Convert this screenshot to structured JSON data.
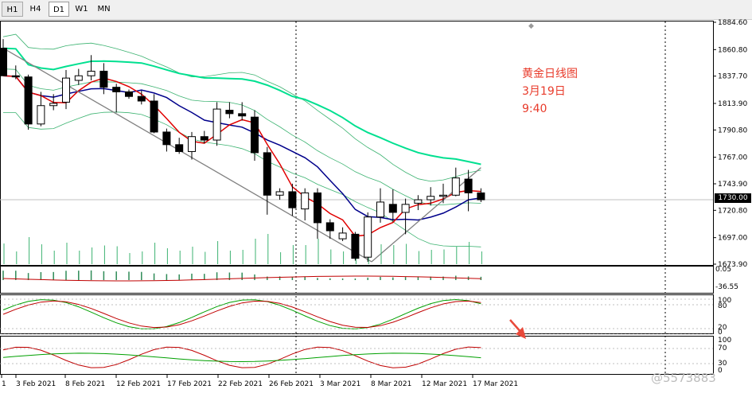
{
  "toolbar": {
    "timeframes": [
      "H1",
      "H4",
      "D1",
      "W1",
      "MN"
    ],
    "active": "D1"
  },
  "annotation": {
    "line1": "黄金日线图",
    "line2": "3月19日",
    "line3": "9:40"
  },
  "watermark": "@5573883",
  "colors": {
    "bull_candle": "#ffffff",
    "bear_candle": "#000000",
    "ma_red": "#e00000",
    "ma_blue": "#00008b",
    "ma_green": "#00e090",
    "bands": "#3cb371",
    "trendline": "#808080",
    "annotation": "#e83a2a",
    "arrow": "#e8493a"
  },
  "chart_data": {
    "type": "candlestick",
    "symbol_timeframe": "D1",
    "price_axis": {
      "ticks": [
        "1884.60",
        "1860.80",
        "1837.70",
        "1813.90",
        "1790.80",
        "1767.00",
        "1743.90",
        "1720.80",
        "1697.00",
        "1673.90"
      ],
      "ylim": [
        1673.9,
        1884.6
      ],
      "current_price": "1730.00"
    },
    "date_axis": [
      "1",
      "3 Feb 2021",
      "8 Feb 2021",
      "12 Feb 2021",
      "17 Feb 2021",
      "22 Feb 2021",
      "26 Feb 2021",
      "3 Mar 2021",
      "8 Mar 2021",
      "12 Mar 2021",
      "17 Mar 2021"
    ],
    "candles": [
      {
        "o": 1862,
        "h": 1870,
        "l": 1838,
        "c": 1838
      },
      {
        "o": 1838,
        "h": 1847,
        "l": 1835,
        "c": 1837
      },
      {
        "o": 1837,
        "h": 1839,
        "l": 1791,
        "c": 1796
      },
      {
        "o": 1796,
        "h": 1824,
        "l": 1794,
        "c": 1812
      },
      {
        "o": 1812,
        "h": 1822,
        "l": 1808,
        "c": 1814
      },
      {
        "o": 1815,
        "h": 1843,
        "l": 1809,
        "c": 1836
      },
      {
        "o": 1834,
        "h": 1844,
        "l": 1830,
        "c": 1838
      },
      {
        "o": 1838,
        "h": 1856,
        "l": 1834,
        "c": 1842
      },
      {
        "o": 1842,
        "h": 1849,
        "l": 1822,
        "c": 1828
      },
      {
        "o": 1828,
        "h": 1831,
        "l": 1806,
        "c": 1824
      },
      {
        "o": 1824,
        "h": 1826,
        "l": 1818,
        "c": 1820
      },
      {
        "o": 1820,
        "h": 1825,
        "l": 1813,
        "c": 1816
      },
      {
        "o": 1816,
        "h": 1822,
        "l": 1788,
        "c": 1789
      },
      {
        "o": 1789,
        "h": 1792,
        "l": 1772,
        "c": 1778
      },
      {
        "o": 1778,
        "h": 1784,
        "l": 1770,
        "c": 1772
      },
      {
        "o": 1772,
        "h": 1789,
        "l": 1765,
        "c": 1785
      },
      {
        "o": 1785,
        "h": 1790,
        "l": 1779,
        "c": 1782
      },
      {
        "o": 1782,
        "h": 1815,
        "l": 1777,
        "c": 1809
      },
      {
        "o": 1808,
        "h": 1815,
        "l": 1801,
        "c": 1805
      },
      {
        "o": 1805,
        "h": 1815,
        "l": 1799,
        "c": 1803
      },
      {
        "o": 1802,
        "h": 1808,
        "l": 1764,
        "c": 1771
      },
      {
        "o": 1771,
        "h": 1776,
        "l": 1717,
        "c": 1734
      },
      {
        "o": 1734,
        "h": 1740,
        "l": 1730,
        "c": 1737
      },
      {
        "o": 1737,
        "h": 1744,
        "l": 1716,
        "c": 1723
      },
      {
        "o": 1722,
        "h": 1740,
        "l": 1712,
        "c": 1736
      },
      {
        "o": 1736,
        "h": 1740,
        "l": 1696,
        "c": 1710
      },
      {
        "o": 1710,
        "h": 1713,
        "l": 1696,
        "c": 1703
      },
      {
        "o": 1696,
        "h": 1706,
        "l": 1694,
        "c": 1701
      },
      {
        "o": 1700,
        "h": 1702,
        "l": 1677,
        "c": 1679
      },
      {
        "o": 1680,
        "h": 1719,
        "l": 1676,
        "c": 1715
      },
      {
        "o": 1715,
        "h": 1740,
        "l": 1710,
        "c": 1728
      },
      {
        "o": 1726,
        "h": 1739,
        "l": 1711,
        "c": 1719
      },
      {
        "o": 1719,
        "h": 1731,
        "l": 1700,
        "c": 1726
      },
      {
        "o": 1727,
        "h": 1734,
        "l": 1721,
        "c": 1730
      },
      {
        "o": 1730,
        "h": 1741,
        "l": 1725,
        "c": 1733
      },
      {
        "o": 1733,
        "h": 1744,
        "l": 1727,
        "c": 1734
      },
      {
        "o": 1734,
        "h": 1758,
        "l": 1733,
        "c": 1749
      },
      {
        "o": 1748,
        "h": 1756,
        "l": 1720,
        "c": 1736
      },
      {
        "o": 1736,
        "h": 1740,
        "l": 1728,
        "c": 1730
      }
    ],
    "subpanels": [
      {
        "name": "volume_like",
        "labels": [
          "0.05",
          "-36.55"
        ]
      },
      {
        "name": "stochastic_1",
        "labels": [
          "100",
          "80",
          "20",
          "0"
        ]
      },
      {
        "name": "stochastic_2",
        "labels": [
          "100",
          "70",
          "30",
          "0"
        ]
      }
    ]
  }
}
